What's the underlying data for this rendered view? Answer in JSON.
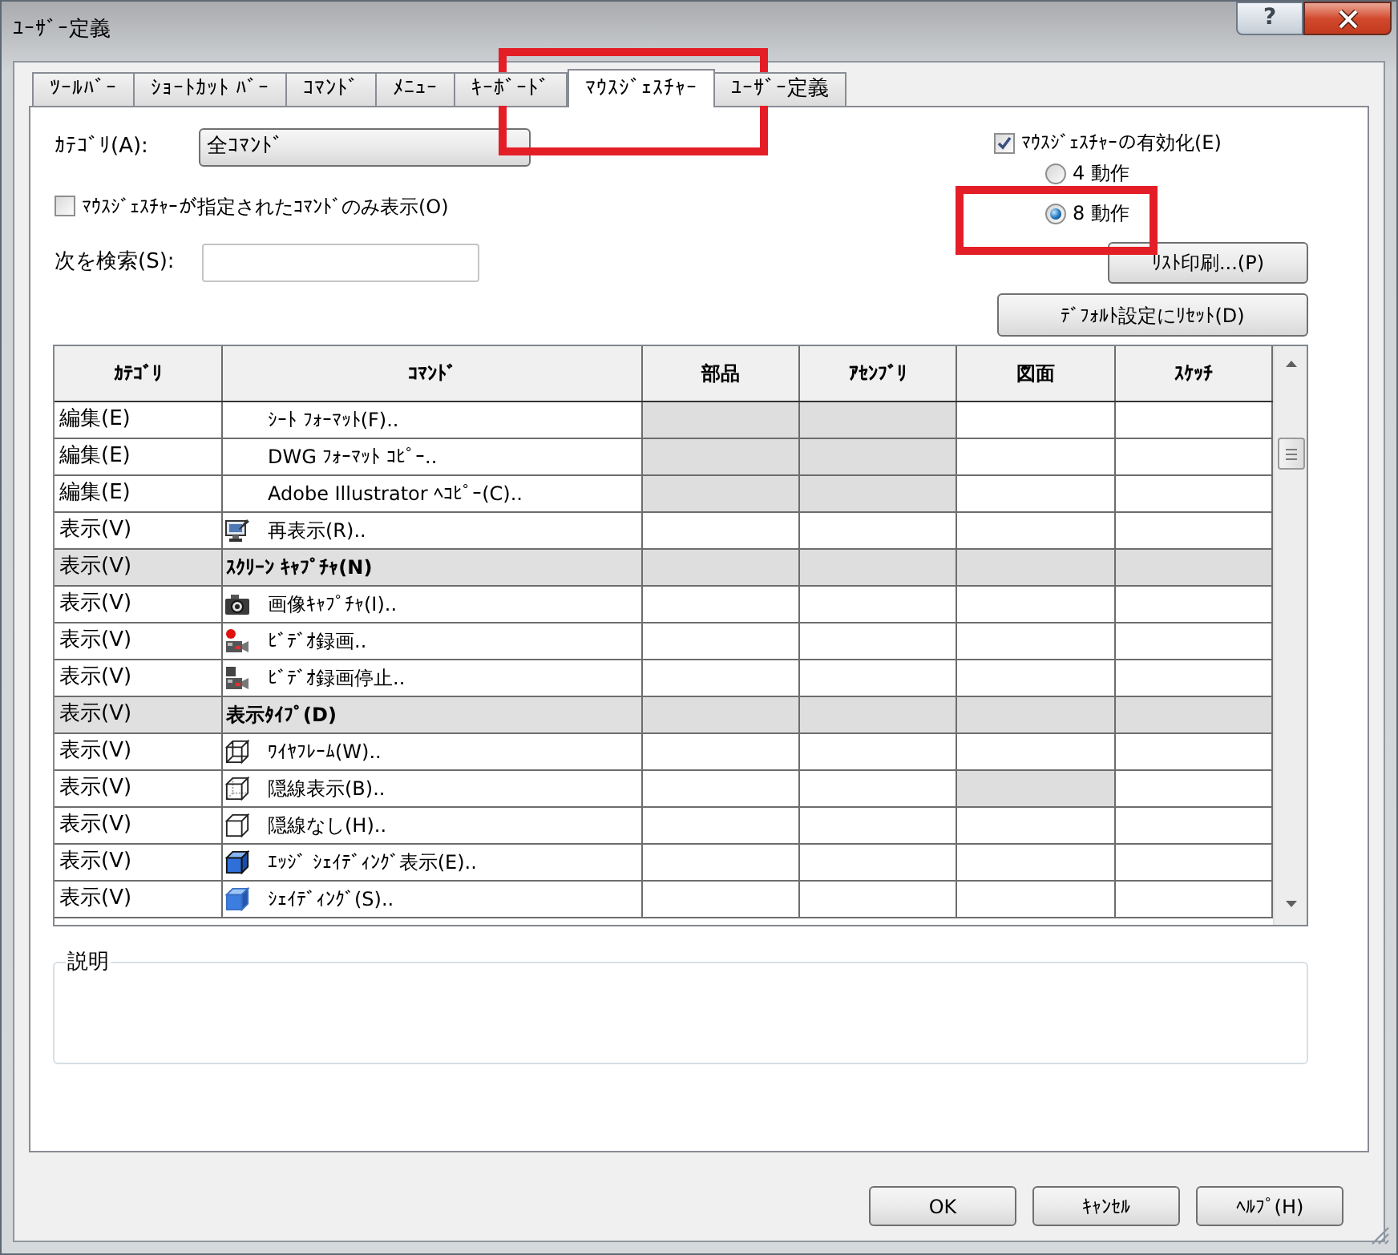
{
  "window": {
    "title": "ﾕｰｻﾞｰ定義",
    "help": "?"
  },
  "tabs": [
    {
      "label": "ﾂｰﾙﾊﾞｰ",
      "selected": false
    },
    {
      "label": "ｼｮｰﾄｶｯﾄ ﾊﾞｰ",
      "selected": false
    },
    {
      "label": "ｺﾏﾝﾄﾞ",
      "selected": false
    },
    {
      "label": "ﾒﾆｭｰ",
      "selected": false
    },
    {
      "label": "ｷｰﾎﾞｰﾄﾞ",
      "selected": false
    },
    {
      "label": "ﾏｳｽｼﾞｪｽﾁｬｰ",
      "selected": true
    },
    {
      "label": "ﾕｰｻﾞｰ定義",
      "selected": false
    }
  ],
  "category": {
    "label": "ｶﾃｺﾞﾘ(A):",
    "value": "全ｺﾏﾝﾄﾞ"
  },
  "filter": {
    "label": "ﾏｳｽｼﾞｪｽﾁｬｰが指定されたｺﾏﾝﾄﾞのみ表示(O)",
    "checked": false
  },
  "search": {
    "label": "次を検索(S):"
  },
  "gestures": {
    "label": "ﾏｳｽｼﾞｪｽﾁｬｰの有効化(E)",
    "checked": true,
    "modes": [
      {
        "label": "4 動作",
        "selected": false
      },
      {
        "label": "8 動作",
        "selected": true
      }
    ]
  },
  "actions": [
    "ﾘｽﾄ印刷...(P)",
    "ﾃﾞﾌｫﾙﾄ設定にﾘｾｯﾄ(D)"
  ],
  "table": {
    "columns": [
      "ｶﾃｺﾞﾘ",
      "ｺﾏﾝﾄﾞ",
      "部品",
      "ｱｾﾝﾌﾞﾘ",
      "図面",
      "ｽｹｯﾁ"
    ],
    "rows": [
      {
        "kind": "command",
        "category": "編集(E)",
        "command": "ｼｰﾄ ﾌｫｰﾏｯﾄ(F)..",
        "slots": [
          {
            "disabled": true
          },
          {
            "disabled": true
          },
          {
            "disabled": false
          },
          {
            "disabled": false
          }
        ]
      },
      {
        "kind": "command",
        "category": "編集(E)",
        "command": "DWG ﾌｫｰﾏｯﾄ ｺﾋﾟｰ..",
        "slots": [
          {
            "disabled": true
          },
          {
            "disabled": true
          },
          {
            "disabled": false
          },
          {
            "disabled": false
          }
        ]
      },
      {
        "kind": "command",
        "category": "編集(E)",
        "command": "Adobe Illustrator ﾍｺﾋﾟｰ(C)..",
        "slots": [
          {
            "disabled": true
          },
          {
            "disabled": true
          },
          {
            "disabled": false
          },
          {
            "disabled": false
          }
        ]
      },
      {
        "kind": "command",
        "category": "表示(V)",
        "command": "再表示(R)..",
        "slots": [
          {
            "disabled": false
          },
          {
            "disabled": false
          },
          {
            "disabled": false
          },
          {
            "disabled": false
          }
        ]
      },
      {
        "kind": "group",
        "category": "表示(V)",
        "command": "ｽｸﾘｰﾝ ｷｬﾌﾟﾁｬ(N)",
        "slots": [
          {
            "disabled": true
          },
          {
            "disabled": true
          },
          {
            "disabled": true
          },
          {
            "disabled": true
          }
        ]
      },
      {
        "kind": "command",
        "category": "表示(V)",
        "command": "画像ｷｬﾌﾟﾁｬ(I)..",
        "slots": [
          {
            "disabled": false
          },
          {
            "disabled": false
          },
          {
            "disabled": false
          },
          {
            "disabled": false
          }
        ]
      },
      {
        "kind": "command",
        "category": "表示(V)",
        "command": "ﾋﾞﾃﾞｵ録画..",
        "slots": [
          {
            "disabled": false
          },
          {
            "disabled": false
          },
          {
            "disabled": false
          },
          {
            "disabled": false
          }
        ]
      },
      {
        "kind": "command",
        "category": "表示(V)",
        "command": "ﾋﾞﾃﾞｵ録画停止..",
        "slots": [
          {
            "disabled": false
          },
          {
            "disabled": false
          },
          {
            "disabled": false
          },
          {
            "disabled": false
          }
        ]
      },
      {
        "kind": "group",
        "category": "表示(V)",
        "command": "表示ﾀｲﾌﾟ(D)",
        "slots": [
          {
            "disabled": true
          },
          {
            "disabled": true
          },
          {
            "disabled": true
          },
          {
            "disabled": true
          }
        ]
      },
      {
        "kind": "command",
        "category": "表示(V)",
        "command": "ﾜｲﾔﾌﾚｰﾑ(W)..",
        "slots": [
          {
            "disabled": false
          },
          {
            "disabled": false
          },
          {
            "disabled": false
          },
          {
            "disabled": false
          }
        ]
      },
      {
        "kind": "command",
        "category": "表示(V)",
        "command": "隠線表示(B)..",
        "slots": [
          {
            "disabled": false
          },
          {
            "disabled": false
          },
          {
            "disabled": true
          },
          {
            "disabled": false
          }
        ]
      },
      {
        "kind": "command",
        "category": "表示(V)",
        "command": "隠線なし(H)..",
        "slots": [
          {
            "disabled": false
          },
          {
            "disabled": false
          },
          {
            "disabled": false
          },
          {
            "disabled": false
          }
        ]
      },
      {
        "kind": "command",
        "category": "表示(V)",
        "command": "ｴｯｼﾞ ｼｪｲﾃﾞｨﾝｸﾞ表示(E)..",
        "slots": [
          {
            "disabled": false
          },
          {
            "disabled": false
          },
          {
            "disabled": false
          },
          {
            "disabled": false
          }
        ]
      },
      {
        "kind": "command",
        "category": "表示(V)",
        "command": "ｼｪｲﾃﾞｨﾝｸﾞ(S)..",
        "slots": [
          {
            "disabled": false
          },
          {
            "disabled": false
          },
          {
            "disabled": false
          },
          {
            "disabled": false
          }
        ]
      }
    ]
  },
  "description": {
    "label": "説明"
  },
  "buttons": [
    "OK",
    "ｷｬﾝｾﾙ",
    "ﾍﾙﾌﾟ(H)"
  ]
}
